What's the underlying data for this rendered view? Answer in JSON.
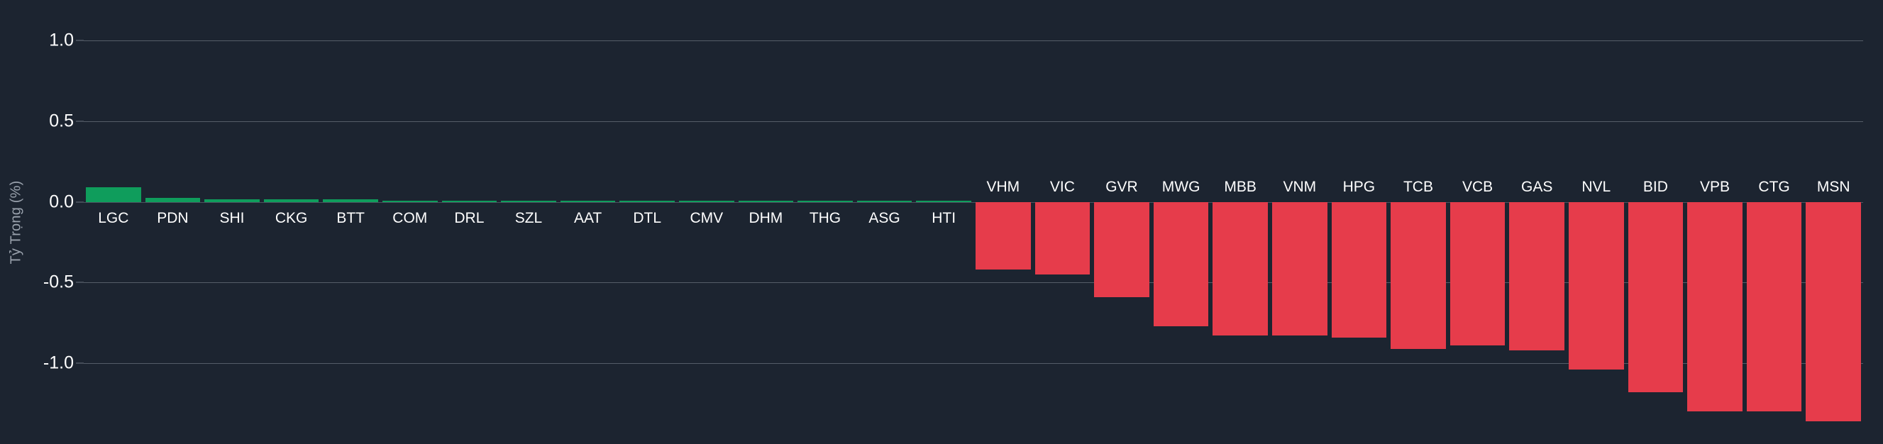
{
  "theme": {
    "background": "#1c2430",
    "positive_color": "#0f9d5c",
    "negative_color": "#e63c4b",
    "gridline_color": "#555d68",
    "tick_text_color": "#ffffff",
    "axis_title_color": "#9aa2ad"
  },
  "axis": {
    "y_title": "Tỷ Trọng (%)",
    "y_ticks": [
      "1.0",
      "0.5",
      "0.0",
      "-0.5",
      "-1.0"
    ]
  },
  "chart_data": {
    "type": "bar",
    "title": "",
    "xlabel": "",
    "ylabel": "Tỷ Trọng (%)",
    "ylim": [
      -1.5,
      1.25
    ],
    "yticks": [
      1.0,
      0.5,
      0.0,
      -0.5,
      -1.0
    ],
    "ytick_labels": [
      "1.0",
      "0.5",
      "0.0",
      "-0.5",
      "-1.0"
    ],
    "grid": true,
    "legend": "none",
    "orientation": "vertical",
    "categories": [
      "LGC",
      "PDN",
      "SHI",
      "CKG",
      "BTT",
      "COM",
      "DRL",
      "SZL",
      "AAT",
      "DTL",
      "CMV",
      "DHM",
      "THG",
      "ASG",
      "HTI",
      "VHM",
      "VIC",
      "GVR",
      "MWG",
      "MBB",
      "VNM",
      "HPG",
      "TCB",
      "VCB",
      "GAS",
      "NVL",
      "BID",
      "VPB",
      "CTG",
      "MSN"
    ],
    "values": [
      0.09,
      0.025,
      0.015,
      0.014,
      0.014,
      0.008,
      0.008,
      0.007,
      0.007,
      0.006,
      0.006,
      0.006,
      0.005,
      0.005,
      0.005,
      -0.42,
      -0.45,
      -0.59,
      -0.77,
      -0.83,
      -0.83,
      -0.84,
      -0.91,
      -0.89,
      -0.92,
      -1.04,
      -1.18,
      -1.3,
      -1.3,
      -1.36
    ],
    "colors": [
      "#0f9d5c",
      "#0f9d5c",
      "#0f9d5c",
      "#0f9d5c",
      "#0f9d5c",
      "#0f9d5c",
      "#0f9d5c",
      "#0f9d5c",
      "#0f9d5c",
      "#0f9d5c",
      "#0f9d5c",
      "#0f9d5c",
      "#0f9d5c",
      "#0f9d5c",
      "#0f9d5c",
      "#e63c4b",
      "#e63c4b",
      "#e63c4b",
      "#e63c4b",
      "#e63c4b",
      "#e63c4b",
      "#e63c4b",
      "#e63c4b",
      "#e63c4b",
      "#e63c4b",
      "#e63c4b",
      "#e63c4b",
      "#e63c4b",
      "#e63c4b",
      "#e63c4b"
    ]
  }
}
